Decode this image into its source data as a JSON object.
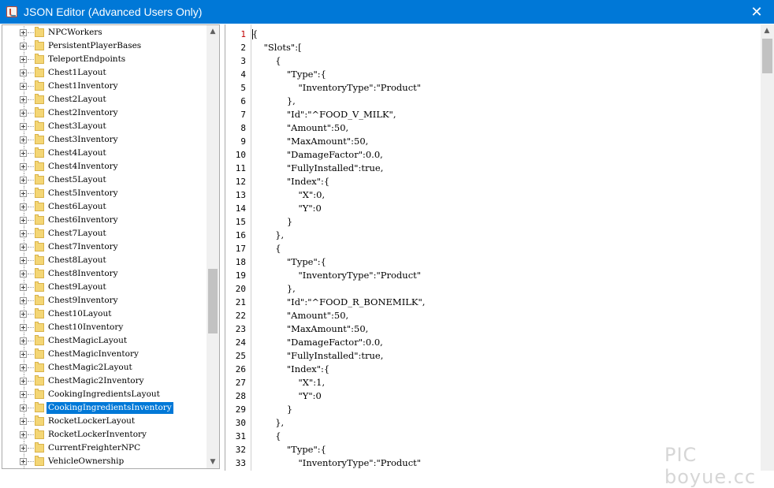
{
  "window": {
    "title": "JSON Editor (Advanced Users Only)",
    "close_glyph": "✕",
    "accent_color": "#0078d7"
  },
  "tree": {
    "items": [
      {
        "label": "NPCWorkers",
        "selected": false
      },
      {
        "label": "PersistentPlayerBases",
        "selected": false
      },
      {
        "label": "TeleportEndpoints",
        "selected": false
      },
      {
        "label": "Chest1Layout",
        "selected": false
      },
      {
        "label": "Chest1Inventory",
        "selected": false
      },
      {
        "label": "Chest2Layout",
        "selected": false
      },
      {
        "label": "Chest2Inventory",
        "selected": false
      },
      {
        "label": "Chest3Layout",
        "selected": false
      },
      {
        "label": "Chest3Inventory",
        "selected": false
      },
      {
        "label": "Chest4Layout",
        "selected": false
      },
      {
        "label": "Chest4Inventory",
        "selected": false
      },
      {
        "label": "Chest5Layout",
        "selected": false
      },
      {
        "label": "Chest5Inventory",
        "selected": false
      },
      {
        "label": "Chest6Layout",
        "selected": false
      },
      {
        "label": "Chest6Inventory",
        "selected": false
      },
      {
        "label": "Chest7Layout",
        "selected": false
      },
      {
        "label": "Chest7Inventory",
        "selected": false
      },
      {
        "label": "Chest8Layout",
        "selected": false
      },
      {
        "label": "Chest8Inventory",
        "selected": false
      },
      {
        "label": "Chest9Layout",
        "selected": false
      },
      {
        "label": "Chest9Inventory",
        "selected": false
      },
      {
        "label": "Chest10Layout",
        "selected": false
      },
      {
        "label": "Chest10Inventory",
        "selected": false
      },
      {
        "label": "ChestMagicLayout",
        "selected": false
      },
      {
        "label": "ChestMagicInventory",
        "selected": false
      },
      {
        "label": "ChestMagic2Layout",
        "selected": false
      },
      {
        "label": "ChestMagic2Inventory",
        "selected": false
      },
      {
        "label": "CookingIngredientsLayout",
        "selected": false
      },
      {
        "label": "CookingIngredientsInventory",
        "selected": true
      },
      {
        "label": "RocketLockerLayout",
        "selected": false
      },
      {
        "label": "RocketLockerInventory",
        "selected": false
      },
      {
        "label": "CurrentFreighterNPC",
        "selected": false
      },
      {
        "label": "VehicleOwnership",
        "selected": false
      }
    ],
    "scroll_up_glyph": "▲",
    "scroll_down_glyph": "▼"
  },
  "editor": {
    "current_line": 1,
    "lines": [
      "{",
      "    \"Slots\":[",
      "        {",
      "            \"Type\":{",
      "                \"InventoryType\":\"Product\"",
      "            },",
      "            \"Id\":\"^FOOD_V_MILK\",",
      "            \"Amount\":50,",
      "            \"MaxAmount\":50,",
      "            \"DamageFactor\":0.0,",
      "            \"FullyInstalled\":true,",
      "            \"Index\":{",
      "                \"X\":0,",
      "                \"Y\":0",
      "            }",
      "        },",
      "        {",
      "            \"Type\":{",
      "                \"InventoryType\":\"Product\"",
      "            },",
      "            \"Id\":\"^FOOD_R_BONEMILK\",",
      "            \"Amount\":50,",
      "            \"MaxAmount\":50,",
      "            \"DamageFactor\":0.0,",
      "            \"FullyInstalled\":true,",
      "            \"Index\":{",
      "                \"X\":1,",
      "                \"Y\":0",
      "            }",
      "        },",
      "        {",
      "            \"Type\":{",
      "                \"InventoryType\":\"Product\""
    ],
    "scroll_up_glyph": "▲"
  },
  "watermark": "PIC boyue.cc"
}
